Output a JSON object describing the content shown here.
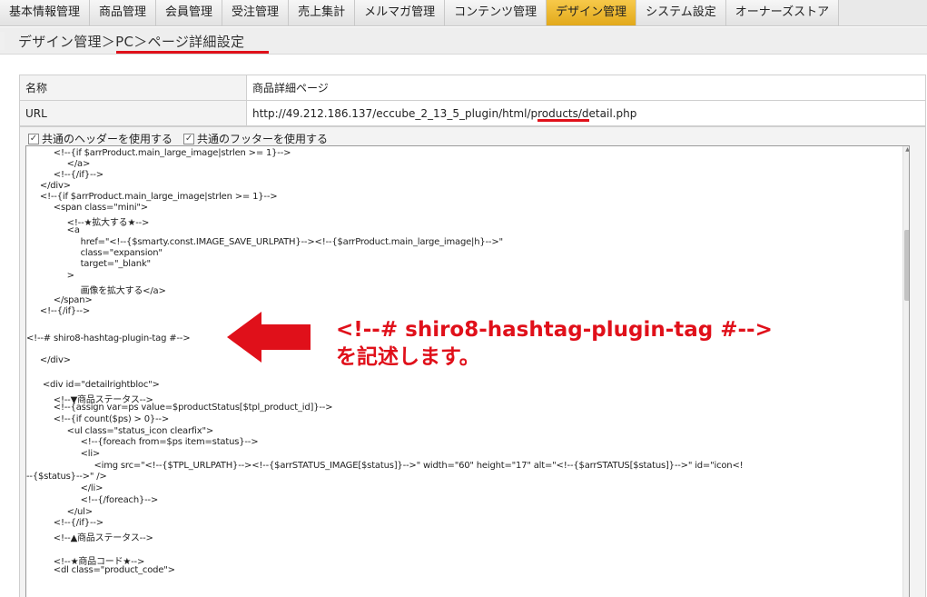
{
  "nav": {
    "tabs": [
      {
        "label": "基本情報管理",
        "active": false
      },
      {
        "label": "商品管理",
        "active": false
      },
      {
        "label": "会員管理",
        "active": false
      },
      {
        "label": "受注管理",
        "active": false
      },
      {
        "label": "売上集計",
        "active": false
      },
      {
        "label": "メルマガ管理",
        "active": false
      },
      {
        "label": "コンテンツ管理",
        "active": false
      },
      {
        "label": "デザイン管理",
        "active": true
      },
      {
        "label": "システム設定",
        "active": false
      },
      {
        "label": "オーナーズストア",
        "active": false
      }
    ]
  },
  "page": {
    "title": "デザイン管理＞PC＞ページ詳細設定"
  },
  "info": {
    "name_label": "名称",
    "name_value": "商品詳細ページ",
    "url_label": "URL",
    "url_value": "http://49.212.186.137/eccube_2_13_5_plugin/html/products/detail.php"
  },
  "options": {
    "use_header": "共通のヘッダーを使用する",
    "use_footer": "共通のフッターを使用する"
  },
  "code": {
    "lines": [
      "          <!--{if $arrProduct.main_large_image|strlen >= 1}-->",
      "               </a>",
      "          <!--{/if}-->",
      "     </div>",
      "     <!--{if $arrProduct.main_large_image|strlen >= 1}-->",
      "          <span class=\"mini\">",
      "               <!--★拡大する★-->",
      "               <a",
      "                    href=\"<!--{$smarty.const.IMAGE_SAVE_URLPATH}--><!--{$arrProduct.main_large_image|h}-->\"",
      "                    class=\"expansion\"",
      "                    target=\"_blank\"",
      "               >",
      "                    画像を拡大する</a>",
      "          </span>",
      "     <!--{/if}-->",
      "",
      "<!--# shiro8-hashtag-plugin-tag #-->",
      "",
      "     </div>",
      "",
      "      <div id=\"detailrightbloc\">",
      "          <!--▼商品ステータス-->",
      "          <!--{assign var=ps value=$productStatus[$tpl_product_id]}-->",
      "          <!--{if count($ps) > 0}-->",
      "               <ul class=\"status_icon clearfix\">",
      "                    <!--{foreach from=$ps item=status}-->",
      "                    <li>",
      "                         <img src=\"<!--{$TPL_URLPATH}--><!--{$arrSTATUS_IMAGE[$status]}-->\" width=\"60\" height=\"17\" alt=\"<!--{$arrSTATUS[$status]}-->\" id=\"icon<!",
      "--{$status}-->\" />",
      "                    </li>",
      "                    <!--{/foreach}-->",
      "               </ul>",
      "          <!--{/if}-->",
      "          <!--▲商品ステータス-->",
      "",
      "          <!--★商品コード★-->",
      "          <dl class=\"product_code\">"
    ]
  },
  "annotation": {
    "line1": "<!--# shiro8-hashtag-plugin-tag #-->",
    "line2": "を記述します。"
  },
  "colors": {
    "accent_red": "#e0101a",
    "active_tab": "#f0b92e"
  }
}
